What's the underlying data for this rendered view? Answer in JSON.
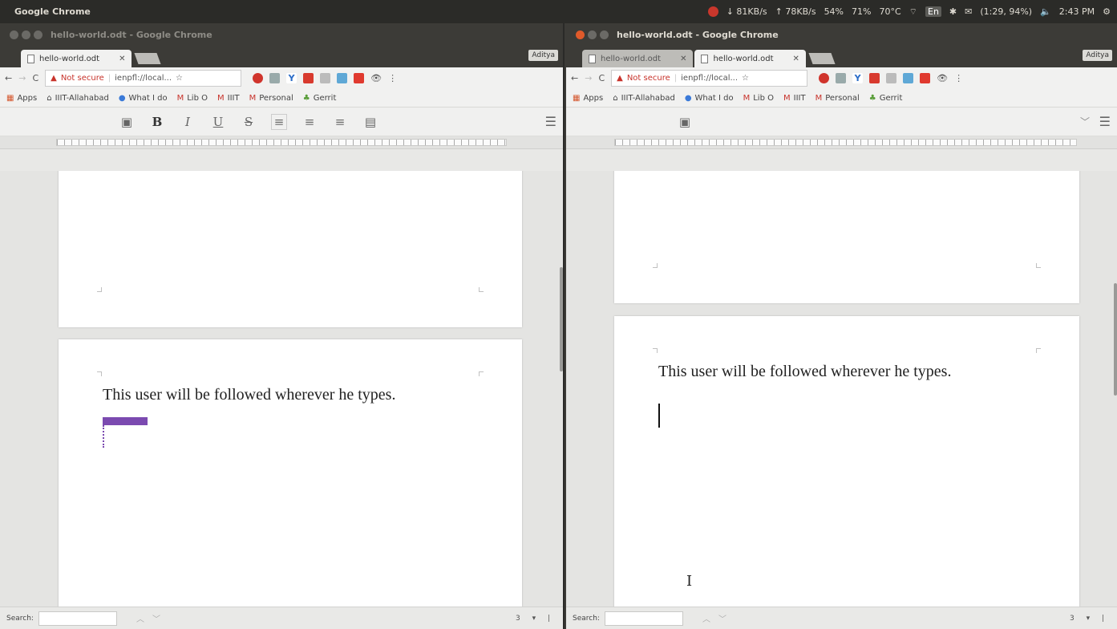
{
  "system_bar": {
    "app_name": "Google Chrome",
    "net_down": "↓ 81KB/s",
    "net_up": "↑ 78KB/s",
    "cpu": "54%",
    "mem": "71%",
    "temp": "70°C",
    "keyboard": "En",
    "battery": "(1:29, 94%)",
    "time": "2:43 PM"
  },
  "left_window": {
    "title": "hello-world.odt - Google Chrome",
    "tabs": [
      {
        "label": "hello-world.odt"
      }
    ],
    "profile": "Aditya",
    "security": "Not secure",
    "url": "ienpfl://local...",
    "bookmarks": [
      "Apps",
      "IIIT-Allahabad",
      "What I do",
      "Lib O",
      "IIIT",
      "Personal",
      "Gerrit"
    ],
    "doc_text": "This user will be followed wherever he types.",
    "find_label": "Search:",
    "page_indicator": "3 ▾ |"
  },
  "right_window": {
    "title": "hello-world.odt - Google Chrome",
    "tabs": [
      {
        "label": "hello-world.odt"
      },
      {
        "label": "hello-world.odt"
      }
    ],
    "profile": "Aditya",
    "security": "Not secure",
    "url": "ienpfl://local...",
    "bookmarks": [
      "Apps",
      "IIIT-Allahabad",
      "What I do",
      "Lib O",
      "IIIT",
      "Personal",
      "Gerrit"
    ],
    "doc_text": "This user will be followed wherever he types.",
    "find_label": "Search:",
    "page_indicator": "3 ▾ |"
  },
  "colors": {
    "collab_cursor": "#7b4ab0",
    "warning": "#c8332b"
  }
}
